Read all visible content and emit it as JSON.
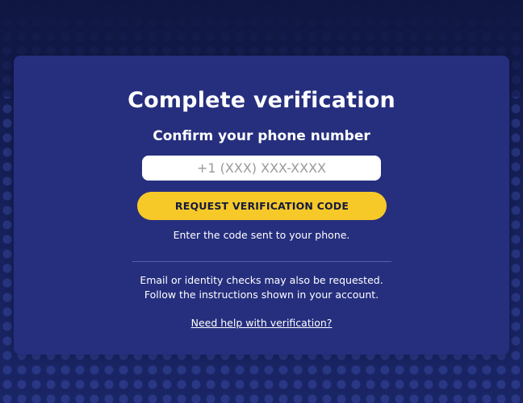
{
  "card": {
    "title": "Complete verification",
    "subtitle": "Confirm your phone number",
    "phone_input": {
      "placeholder": "+1 (XXX) XXX-XXXX",
      "value": ""
    },
    "request_button_label": "REQUEST VERIFICATION CODE",
    "hint": "Enter the code sent to your phone.",
    "note_line_1": "Email or identity checks may also be requested.",
    "note_line_2": "Follow the instructions shown in your account.",
    "help_link": "Need help with verification?"
  },
  "colors": {
    "page_background": "#121a4a",
    "card_background": "#262f7e",
    "button_accent": "#f7c928",
    "text": "#ffffff"
  }
}
